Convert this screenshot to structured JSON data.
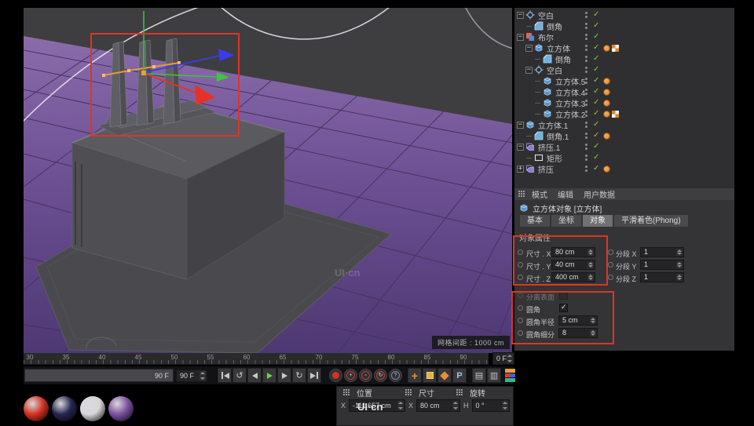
{
  "annotation_color": "#dd3526",
  "watermark": "UI·cn",
  "viewport": {
    "grid_spacing_label": "网格间距 : 1000 cm"
  },
  "object_manager": {
    "rows": [
      {
        "label": "空白",
        "indent": 0,
        "icon": "null-icon",
        "expander": "minus",
        "tags": []
      },
      {
        "label": "倒角",
        "indent": 1,
        "icon": "bevel-icon",
        "expander": "none",
        "tags": []
      },
      {
        "label": "布尔",
        "indent": 0,
        "icon": "boole-icon",
        "expander": "minus",
        "tags": []
      },
      {
        "label": "立方体",
        "indent": 1,
        "icon": "cube-icon",
        "expander": "minus",
        "tags": [
          "texture",
          "checker"
        ]
      },
      {
        "label": "倒角",
        "indent": 2,
        "icon": "bevel-icon",
        "expander": "none",
        "tags": []
      },
      {
        "label": "空白",
        "indent": 1,
        "icon": "null-icon",
        "expander": "minus",
        "tags": []
      },
      {
        "label": "立方体.5",
        "indent": 2,
        "icon": "cube-icon",
        "expander": "none",
        "tags": [
          "texture"
        ]
      },
      {
        "label": "立方体.4",
        "indent": 2,
        "icon": "cube-icon",
        "expander": "none",
        "tags": [
          "texture"
        ]
      },
      {
        "label": "立方体.3",
        "indent": 2,
        "icon": "cube-icon",
        "expander": "none",
        "tags": [
          "texture"
        ]
      },
      {
        "label": "立方体.2",
        "indent": 2,
        "icon": "cube-icon",
        "expander": "none",
        "tags": [
          "texture",
          "checker"
        ]
      },
      {
        "label": "立方体.1",
        "indent": 0,
        "icon": "cube-icon",
        "expander": "minus",
        "tags": []
      },
      {
        "label": "倒角.1",
        "indent": 1,
        "icon": "bevel-icon",
        "expander": "none",
        "tags": [
          "texture"
        ]
      },
      {
        "label": "挤压.1",
        "indent": 0,
        "icon": "extrude-icon",
        "expander": "minus",
        "tags": []
      },
      {
        "label": "矩形",
        "indent": 1,
        "icon": "rect-icon",
        "expander": "none",
        "tags": []
      },
      {
        "label": "挤压",
        "indent": 0,
        "icon": "extrude-icon",
        "expander": "plus",
        "tags": [
          "texture"
        ]
      }
    ]
  },
  "attribute_manager": {
    "menu_items": [
      "模式",
      "编辑",
      "用户数据"
    ],
    "object_title": "立方体对象 [立方体]",
    "tabs": [
      "基本",
      "坐标",
      "对象",
      "平滑着色(Phong)"
    ],
    "active_tab": "对象",
    "section_title": "对象属性",
    "size_rows": [
      {
        "label": "尺寸 . X",
        "value": "80 cm",
        "seg_label": "分段 X",
        "seg_value": "1"
      },
      {
        "label": "尺寸 . Y",
        "value": "40 cm",
        "seg_label": "分段 Y",
        "seg_value": "1"
      },
      {
        "label": "尺寸 . Z",
        "value": "400 cm",
        "seg_label": "分段 Z",
        "seg_value": "1"
      }
    ],
    "separate_surfaces_label": "分离表面",
    "fillet_rows": {
      "toggle_label": "圆角",
      "toggle_checked": true,
      "radius_label": "圆角半径",
      "radius_value": "5 cm",
      "subdivision_label": "圆角细分",
      "subdivision_value": "8"
    }
  },
  "timeline": {
    "tick_labels": [
      "30",
      "35",
      "40",
      "45",
      "50",
      "55",
      "60",
      "65",
      "70",
      "75",
      "80",
      "85",
      "90"
    ],
    "end_frame_value": "0 F",
    "range_bar_value": "90 F",
    "current_frame_value": "90 F"
  },
  "transport": {
    "nav_buttons": [
      {
        "name": "goto-start-button",
        "shape": "start"
      },
      {
        "name": "play-backwards-button",
        "shape": "ccw"
      },
      {
        "name": "previous-frame-button",
        "shape": "prev"
      },
      {
        "name": "play-button",
        "shape": "play"
      },
      {
        "name": "next-frame-button",
        "shape": "next"
      },
      {
        "name": "play-loop-button",
        "shape": "cw"
      },
      {
        "name": "goto-end-button",
        "shape": "end"
      }
    ],
    "record_buttons": [
      {
        "name": "record-button",
        "glyph": "dot"
      },
      {
        "name": "record-position-button",
        "glyph": "cross"
      },
      {
        "name": "record-scale-button",
        "glyph": "box"
      },
      {
        "name": "record-rotation-button",
        "glyph": "rotate"
      },
      {
        "name": "record-parameter-button",
        "glyph": "question"
      }
    ],
    "option_buttons": [
      {
        "name": "autokey-button",
        "glyph": "plus"
      },
      {
        "name": "keyframe-selection-button",
        "glyph": "square"
      },
      {
        "name": "keyframe-region-button",
        "glyph": "diamond"
      },
      {
        "name": "preferences-button",
        "glyph": "P"
      }
    ],
    "list_buttons": [
      {
        "name": "timeline-mode-button"
      },
      {
        "name": "fcurve-mode-button"
      }
    ],
    "mini_chips": [
      {
        "name": "mini-chip-orange"
      },
      {
        "name": "mini-chip-redblue"
      },
      {
        "name": "mini-chip-green"
      }
    ]
  },
  "coordinates": {
    "position_header": "位置",
    "size_header": "尺寸",
    "rotation_header": "旋转",
    "position_x_label": "X",
    "position_x_value": "-111.657 cm",
    "size_x_label": "X",
    "size_x_value": "80 cm",
    "rotation_h_label": "H",
    "rotation_h_value": "0 °"
  },
  "materials": [
    {
      "name": "red-material",
      "color": "#d23222"
    },
    {
      "name": "dark-blue-material",
      "color": "#26264e"
    },
    {
      "name": "light-material",
      "color": "#d8d8dc"
    },
    {
      "name": "purple-material",
      "color": "#7b50a2"
    }
  ]
}
